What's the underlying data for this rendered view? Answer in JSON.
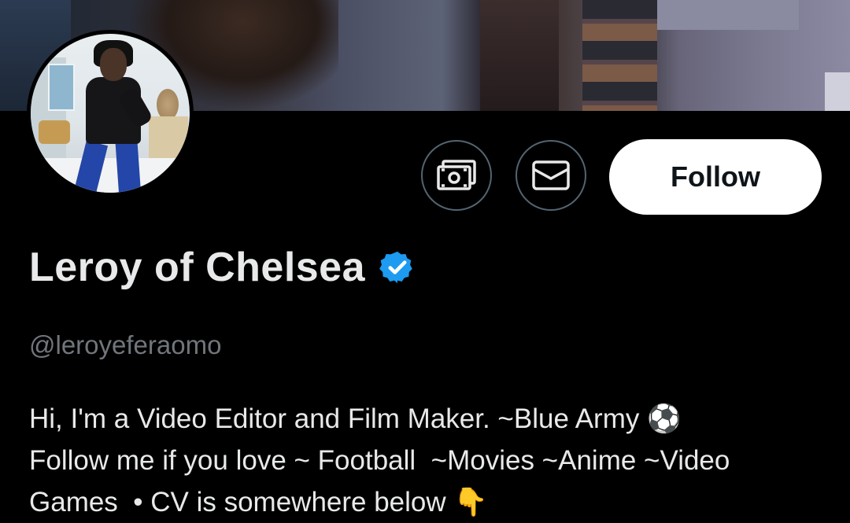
{
  "profile": {
    "display_name": "Leroy of Chelsea",
    "handle": "@leroyeferaomo",
    "verified": true,
    "bio_line1": "Hi, I'm a Video Editor and Film Maker. ~Blue Army ⚽",
    "bio_line2": "Follow me if you love ~ Football  ~Movies ~Anime ~Video",
    "bio_line3": "Games  • CV is somewhere below 👇"
  },
  "actions": {
    "follow_label": "Follow",
    "tip_icon": "money-icon",
    "message_icon": "envelope-icon"
  },
  "colors": {
    "background": "#000000",
    "text_primary": "#e7e9ea",
    "text_secondary": "#71767b",
    "verified_blue": "#1d9bf0",
    "follow_bg": "#ffffff",
    "follow_text": "#0f1419",
    "icon_button_border": "#536471"
  }
}
